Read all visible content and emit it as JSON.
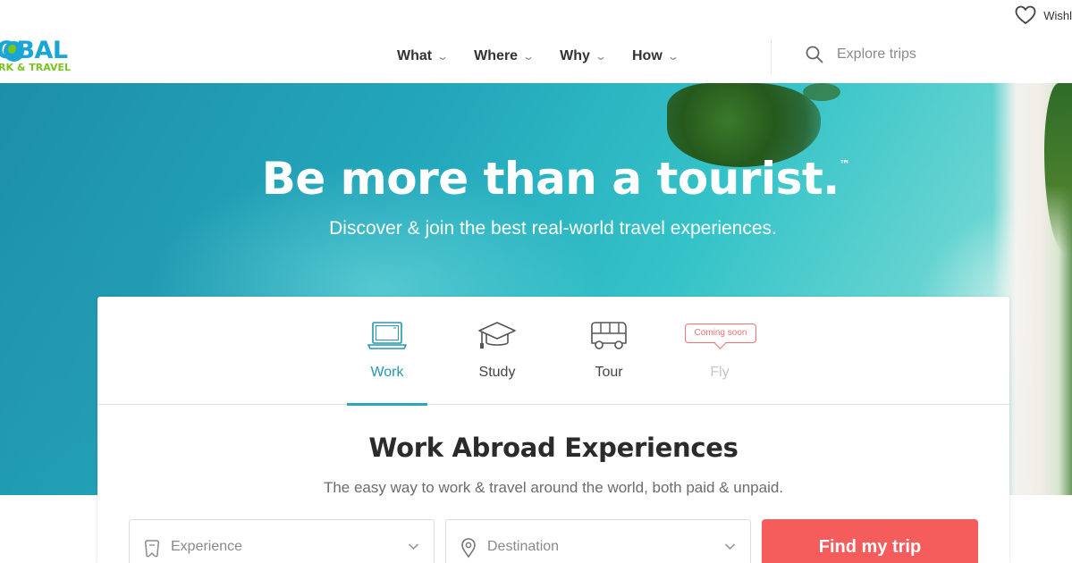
{
  "utility": {
    "wishlist_label": "Wishl"
  },
  "logo": {
    "line1": "OBAL",
    "line2": "RK & TRAVEL"
  },
  "nav": {
    "items": [
      {
        "label": "What"
      },
      {
        "label": "Where"
      },
      {
        "label": "Why"
      },
      {
        "label": "How"
      }
    ],
    "search_placeholder": "Explore trips"
  },
  "hero": {
    "title": "Be more than a tourist.",
    "title_mark": "™",
    "subtitle": "Discover & join the best real-world travel experiences."
  },
  "tabs": [
    {
      "label": "Work",
      "icon": "laptop-icon",
      "state": "active"
    },
    {
      "label": "Study",
      "icon": "graduation-cap-icon",
      "state": "default"
    },
    {
      "label": "Tour",
      "icon": "bus-icon",
      "state": "default"
    },
    {
      "label": "Fly",
      "icon": "",
      "state": "disabled",
      "badge": "Coming soon"
    }
  ],
  "section": {
    "title": "Work Abroad Experiences",
    "subtitle": "The easy way to work & travel around the world, both paid & unpaid."
  },
  "form": {
    "experience_placeholder": "Experience",
    "destination_placeholder": "Destination",
    "submit_label": "Find my trip"
  },
  "colors": {
    "accent_teal": "#2ca6bd",
    "cta_red": "#f55c5c",
    "badge_pink": "#f07276",
    "logo_blue": "#19a6d6",
    "logo_green": "#79c51d"
  }
}
